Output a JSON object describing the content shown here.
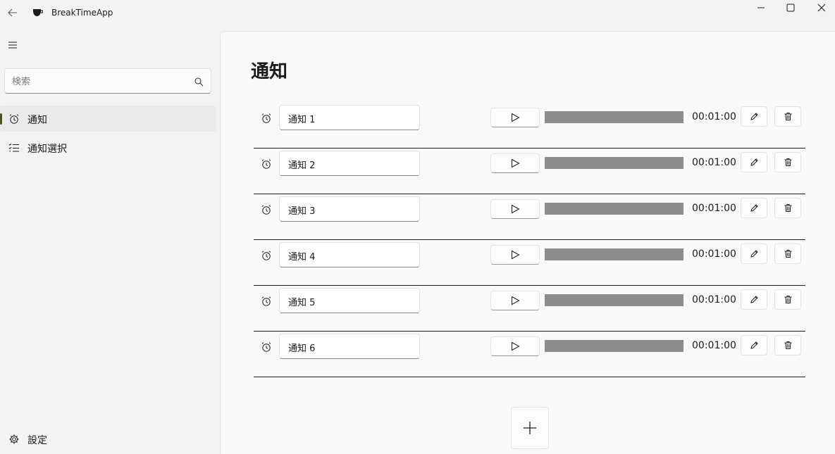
{
  "titlebar": {
    "app_title": "BreakTimeApp"
  },
  "sidebar": {
    "search_placeholder": "検索",
    "items": [
      {
        "label": "通知",
        "icon": "alarm-clock-icon",
        "selected": true
      },
      {
        "label": "通知選択",
        "icon": "checklist-icon",
        "selected": false
      }
    ],
    "settings_label": "設定"
  },
  "main": {
    "title": "通知",
    "notifications": [
      {
        "name": "通知 1",
        "time": "00:01:00",
        "progress": 1.0
      },
      {
        "name": "通知 2",
        "time": "00:01:00",
        "progress": 1.0
      },
      {
        "name": "通知 3",
        "time": "00:01:00",
        "progress": 1.0
      },
      {
        "name": "通知 4",
        "time": "00:01:00",
        "progress": 1.0
      },
      {
        "name": "通知 5",
        "time": "00:01:00",
        "progress": 1.0
      },
      {
        "name": "通知 6",
        "time": "00:01:00",
        "progress": 1.0
      }
    ]
  },
  "colors": {
    "accent": "#4a5420",
    "progress_fill": "#8c8c8c",
    "background": "#f3f3f3"
  }
}
